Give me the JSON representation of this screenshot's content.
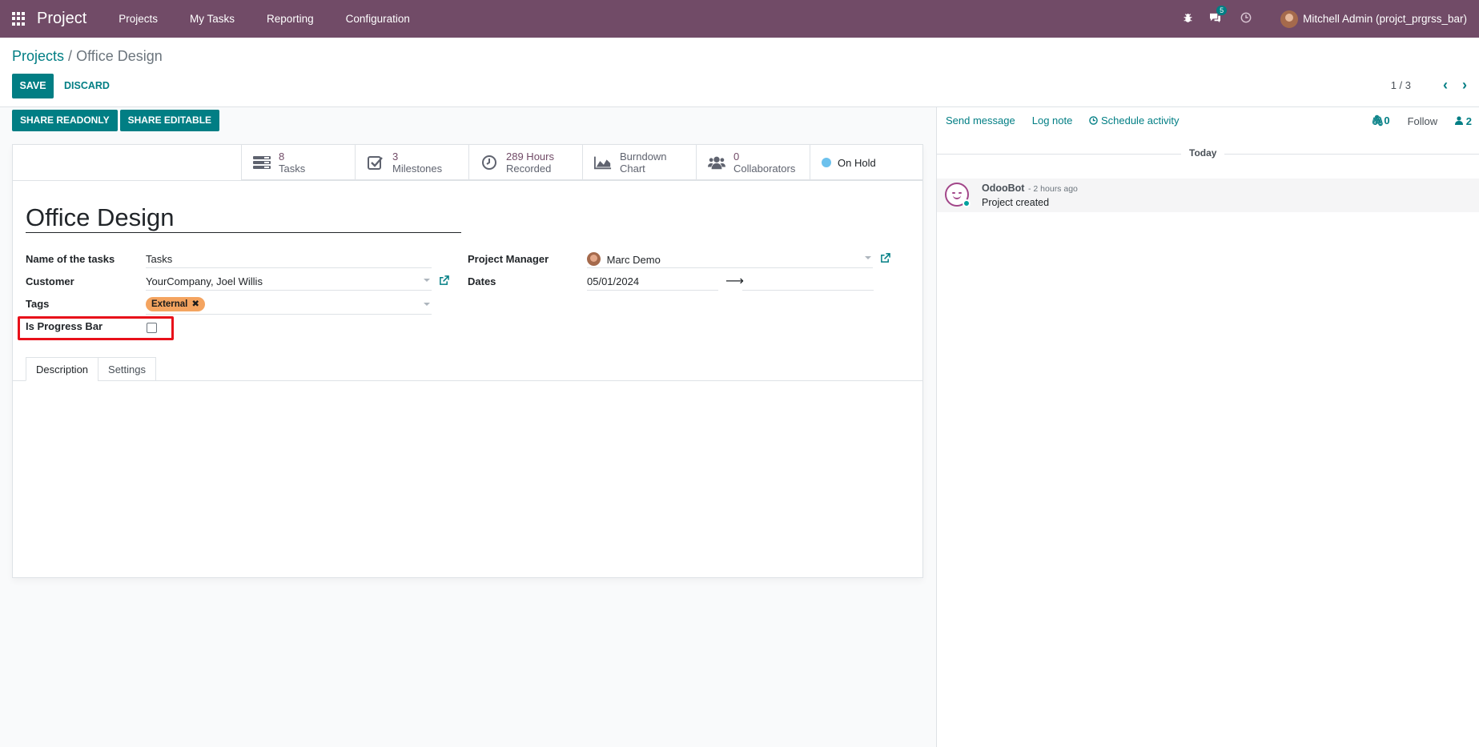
{
  "navbar": {
    "brand": "Project",
    "menu": [
      "Projects",
      "My Tasks",
      "Reporting",
      "Configuration"
    ],
    "messages_badge": "5",
    "user": "Mitchell Admin (projct_prgrss_bar)"
  },
  "breadcrumb": {
    "parent": "Projects",
    "separator": "/",
    "current": "Office Design"
  },
  "toolbar": {
    "save": "SAVE",
    "discard": "DISCARD"
  },
  "pager": {
    "value": "1 / 3"
  },
  "share": {
    "readonly": "SHARE READONLY",
    "editable": "SHARE EDITABLE"
  },
  "smart_buttons": {
    "tasks": {
      "value": "8",
      "label": "Tasks"
    },
    "milestones": {
      "value": "3",
      "label": "Milestones"
    },
    "hours": {
      "value": "289 Hours",
      "label": "Recorded"
    },
    "burndown": {
      "line1": "Burndown",
      "line2": "Chart"
    },
    "collaborators": {
      "value": "0",
      "label": "Collaborators"
    },
    "status": {
      "label": "On Hold",
      "color": "#6cc1ed"
    }
  },
  "form": {
    "title": "Office Design",
    "labels": {
      "name_of_tasks": "Name of the tasks",
      "customer": "Customer",
      "tags": "Tags",
      "is_progress_bar": "Is Progress Bar",
      "project_manager": "Project Manager",
      "dates": "Dates"
    },
    "values": {
      "name_of_tasks": "Tasks",
      "customer": "YourCompany, Joel Willis",
      "tag": "External",
      "is_progress_bar": false,
      "project_manager": "Marc Demo",
      "date_start": "05/01/2024",
      "date_end": ""
    },
    "tabs": [
      "Description",
      "Settings"
    ]
  },
  "chatter": {
    "send_message": "Send message",
    "log_note": "Log note",
    "schedule_activity": "Schedule activity",
    "attachments": "0",
    "follow": "Follow",
    "followers": "2",
    "separator": "Today",
    "message": {
      "author": "OdooBot",
      "time": "- 2 hours ago",
      "body": "Project created"
    }
  },
  "colors": {
    "brand": "#714b67",
    "accent": "#017e84",
    "highlight": "#e8101a",
    "tag": "#f4a460"
  }
}
